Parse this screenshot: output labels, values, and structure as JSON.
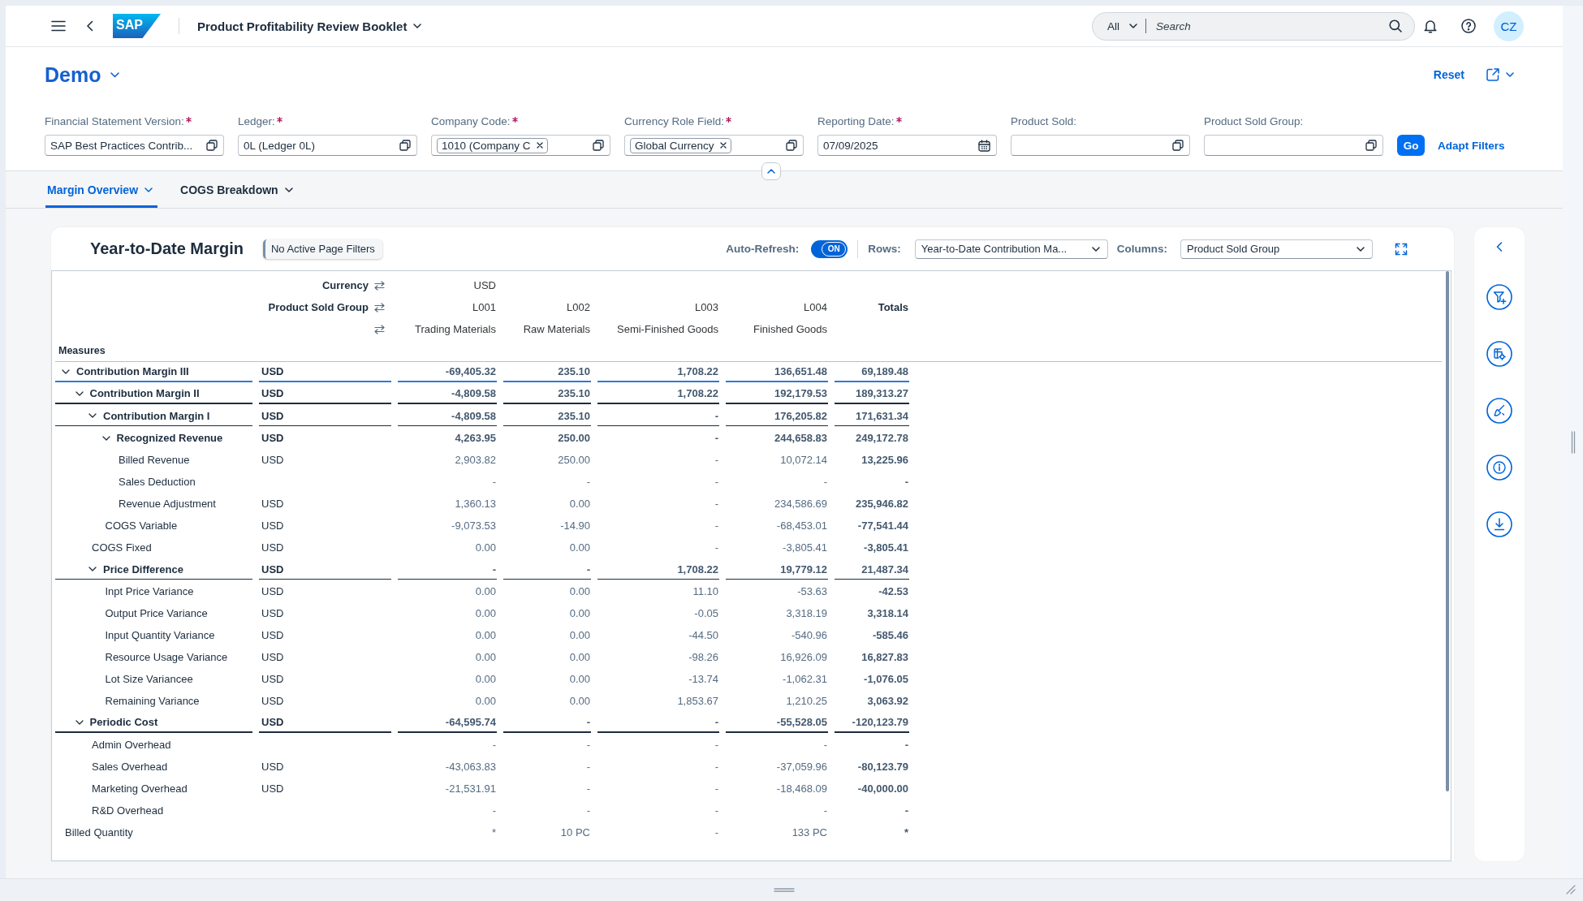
{
  "shell_bar": {
    "logo": "SAP",
    "title": "Product Profitability Review Booklet",
    "search": {
      "scope": "All",
      "placeholder": "Search"
    },
    "avatar_initials": "CZ"
  },
  "header": {
    "variant": "Demo",
    "reset": "Reset"
  },
  "filter_bar": {
    "filters": [
      {
        "label": "Financial Statement Version:",
        "required": true,
        "kind": "input",
        "value": "SAP Best Practices Contrib..."
      },
      {
        "label": "Ledger:",
        "required": true,
        "kind": "input",
        "value": "0L (Ledger 0L)"
      },
      {
        "label": "Company Code:",
        "required": true,
        "kind": "tokens",
        "tokens": [
          "1010 (Company C"
        ]
      },
      {
        "label": "Currency Role Field:",
        "required": true,
        "kind": "tokens",
        "tokens": [
          "Global Currency"
        ]
      },
      {
        "label": "Reporting Date:",
        "required": true,
        "kind": "date",
        "value": "07/09/2025"
      },
      {
        "label": "Product Sold:",
        "required": false,
        "kind": "input"
      },
      {
        "label": "Product Sold Group:",
        "required": false,
        "kind": "input"
      }
    ],
    "go": "Go",
    "adapt": "Adapt Filters"
  },
  "tabs": [
    {
      "label": "Margin Overview",
      "selected": true
    },
    {
      "label": "COGS Breakdown",
      "selected": false
    }
  ],
  "card": {
    "title": "Year-to-Date Margin",
    "filter_status": "No Active Page Filters",
    "auto_refresh": {
      "label": "Auto-Refresh:",
      "on": true,
      "text": "ON"
    },
    "rows_select": {
      "label": "Rows:",
      "value": "Year-to-Date Contribution Ma..."
    },
    "columns_select": {
      "label": "Columns:",
      "value": "Product Sold Group"
    }
  },
  "table": {
    "dimension_rows": [
      {
        "label": "Currency",
        "values": [
          "USD"
        ]
      },
      {
        "label": "Product Sold Group",
        "values": [
          "L001",
          "L002",
          "L003",
          "L004",
          "Totals"
        ]
      },
      {
        "values": [
          "Trading Materials",
          "Raw Materials",
          "Semi-Finished Goods",
          "Finished Goods"
        ]
      }
    ],
    "measures_label": "Measures",
    "rows": [
      {
        "label": "Contribution Margin III",
        "unit": "USD",
        "values": [
          "-69,405.32",
          "235.10",
          "1,708.22",
          "136,651.48",
          "69,189.48"
        ],
        "expanded": true,
        "children": [
          {
            "label": "Contribution Margin II",
            "unit": "USD",
            "values": [
              "-4,809.58",
              "235.10",
              "1,708.22",
              "192,179.53",
              "189,313.27"
            ],
            "expanded": true,
            "children": [
              {
                "label": "Contribution Margin I",
                "unit": "USD",
                "values": [
                  "-4,809.58",
                  "235.10",
                  "-",
                  "176,205.82",
                  "171,631.34"
                ],
                "expanded": true,
                "children": [
                  {
                    "label": "Recognized Revenue",
                    "unit": "USD",
                    "values": [
                      "4,263.95",
                      "250.00",
                      "-",
                      "244,658.83",
                      "249,172.78"
                    ],
                    "expanded": true,
                    "children": [
                      {
                        "label": "Billed Revenue",
                        "unit": "USD",
                        "values": [
                          "2,903.82",
                          "250.00",
                          "-",
                          "10,072.14",
                          "13,225.96"
                        ]
                      },
                      {
                        "label": "Sales Deduction",
                        "values": [
                          "-",
                          "-",
                          "-",
                          "-",
                          "-"
                        ]
                      },
                      {
                        "label": "Revenue Adjustment",
                        "unit": "USD",
                        "values": [
                          "1,360.13",
                          "0.00",
                          "-",
                          "234,586.69",
                          "235,946.82"
                        ]
                      }
                    ]
                  },
                  {
                    "label": "COGS Variable",
                    "unit": "USD",
                    "values": [
                      "-9,073.53",
                      "-14.90",
                      "-",
                      "-68,453.01",
                      "-77,541.44"
                    ]
                  }
                ]
              },
              {
                "label": "COGS Fixed",
                "unit": "USD",
                "values": [
                  "0.00",
                  "0.00",
                  "-",
                  "-3,805.41",
                  "-3,805.41"
                ]
              },
              {
                "label": "Price Difference",
                "unit": "USD",
                "values": [
                  "-",
                  "-",
                  "1,708.22",
                  "19,779.12",
                  "21,487.34"
                ],
                "expanded": true,
                "children": [
                  {
                    "label": "Inpt Price Variance",
                    "unit": "USD",
                    "values": [
                      "0.00",
                      "0.00",
                      "11.10",
                      "-53.63",
                      "-42.53"
                    ]
                  },
                  {
                    "label": "Output Price Variance",
                    "unit": "USD",
                    "values": [
                      "0.00",
                      "0.00",
                      "-0.05",
                      "3,318.19",
                      "3,318.14"
                    ]
                  },
                  {
                    "label": "Input Quantity Variance",
                    "unit": "USD",
                    "values": [
                      "0.00",
                      "0.00",
                      "-44.50",
                      "-540.96",
                      "-585.46"
                    ]
                  },
                  {
                    "label": "Resource Usage Variance",
                    "unit": "USD",
                    "values": [
                      "0.00",
                      "0.00",
                      "-98.26",
                      "16,926.09",
                      "16,827.83"
                    ]
                  },
                  {
                    "label": "Lot Size Variancee",
                    "unit": "USD",
                    "values": [
                      "0.00",
                      "0.00",
                      "-13.74",
                      "-1,062.31",
                      "-1,076.05"
                    ]
                  },
                  {
                    "label": "Remaining Variance",
                    "unit": "USD",
                    "values": [
                      "0.00",
                      "0.00",
                      "1,853.67",
                      "1,210.25",
                      "3,063.92"
                    ]
                  }
                ]
              }
            ]
          },
          {
            "label": "Periodic Cost",
            "unit": "USD",
            "values": [
              "-64,595.74",
              "-",
              "-",
              "-55,528.05",
              "-120,123.79"
            ],
            "expanded": true,
            "children": [
              {
                "label": "Admin Overhead",
                "values": [
                  "-",
                  "-",
                  "-",
                  "-",
                  "-"
                ]
              },
              {
                "label": "Sales Overhead",
                "unit": "USD",
                "values": [
                  "-43,063.83",
                  "-",
                  "-",
                  "-37,059.96",
                  "-80,123.79"
                ]
              },
              {
                "label": "Marketing Overhead",
                "unit": "USD",
                "values": [
                  "-21,531.91",
                  "-",
                  "-",
                  "-18,468.09",
                  "-40,000.00"
                ]
              },
              {
                "label": "R&D Overhead",
                "values": [
                  "-",
                  "-",
                  "-",
                  "-",
                  "-"
                ]
              }
            ]
          }
        ]
      },
      {
        "label": "Billed Quantity",
        "values": [
          "*",
          "10 PC",
          "-",
          "133 PC",
          "*"
        ]
      }
    ]
  }
}
